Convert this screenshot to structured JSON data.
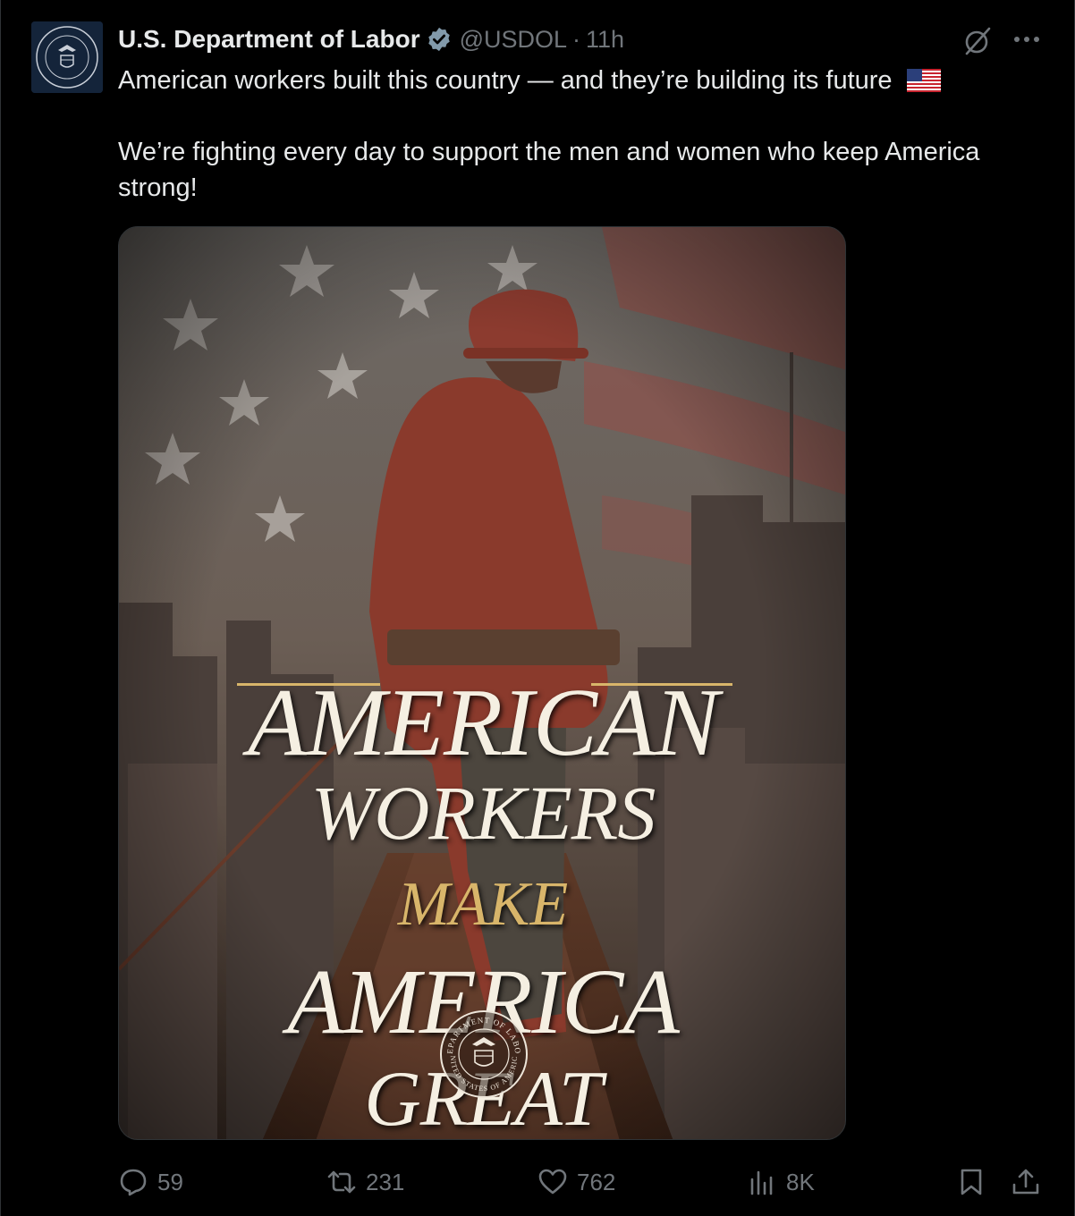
{
  "author": {
    "name": "U.S. Department of Labor",
    "handle": "@USDOL",
    "separator": "·",
    "time": "11h"
  },
  "tweet": {
    "line1": "American workers built this country — and they’re building its future",
    "line2": "We’re fighting every day to support the men and women who keep America strong!"
  },
  "poster": {
    "line1": "AMERICAN",
    "line2": "WORKERS",
    "line3": "MAKE",
    "line4": "AMERICA",
    "line5": "GREAT",
    "seal_text_top": "DEPARTMENT OF LABOR",
    "seal_text_bottom": "UNITED STATES OF AMERICA"
  },
  "actions": {
    "replies": "59",
    "reposts": "231",
    "likes": "762",
    "views": "8K"
  },
  "colors": {
    "background": "#000000",
    "text": "#e7e9ea",
    "muted": "#71767b",
    "verified": "#829aab",
    "poster_gold": "#d8b56a"
  }
}
